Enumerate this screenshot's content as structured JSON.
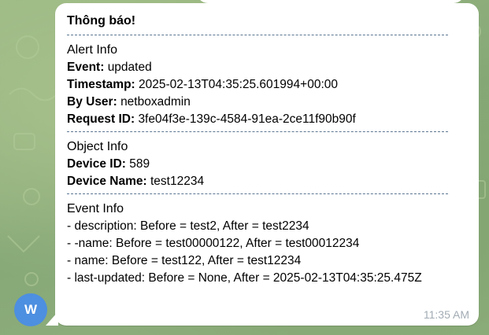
{
  "message": {
    "title": "Thông báo!",
    "alert_info": {
      "heading": "Alert Info",
      "event_label": "Event:",
      "event_value": "updated",
      "timestamp_label": "Timestamp:",
      "timestamp_value": "2025-02-13T04:35:25.601994+00:00",
      "user_label": "By User:",
      "user_value": "netboxadmin",
      "request_label": "Request ID:",
      "request_value": "3fe04f3e-139c-4584-91ea-2ce11f90b90f"
    },
    "object_info": {
      "heading": "Object Info",
      "device_id_label": "Device ID:",
      "device_id_value": "589",
      "device_name_label": "Device Name:",
      "device_name_value": "test12234"
    },
    "event_info": {
      "heading": "Event Info",
      "changes": [
        "- description: Before = test2, After = test2234",
        "- -name: Before = test00000122, After = test00012234",
        "- name: Before = test122, After = test12234",
        "- last-updated: Before = None, After = 2025-02-13T04:35:25.475Z"
      ]
    },
    "time": "11:35 AM"
  },
  "sender": {
    "avatar_letter": "W",
    "avatar_color": "#4d8fe0"
  },
  "colors": {
    "bubble": "#ffffff",
    "background": "#8fb07e",
    "separator": "#5b7691",
    "time": "#a2acb4"
  }
}
